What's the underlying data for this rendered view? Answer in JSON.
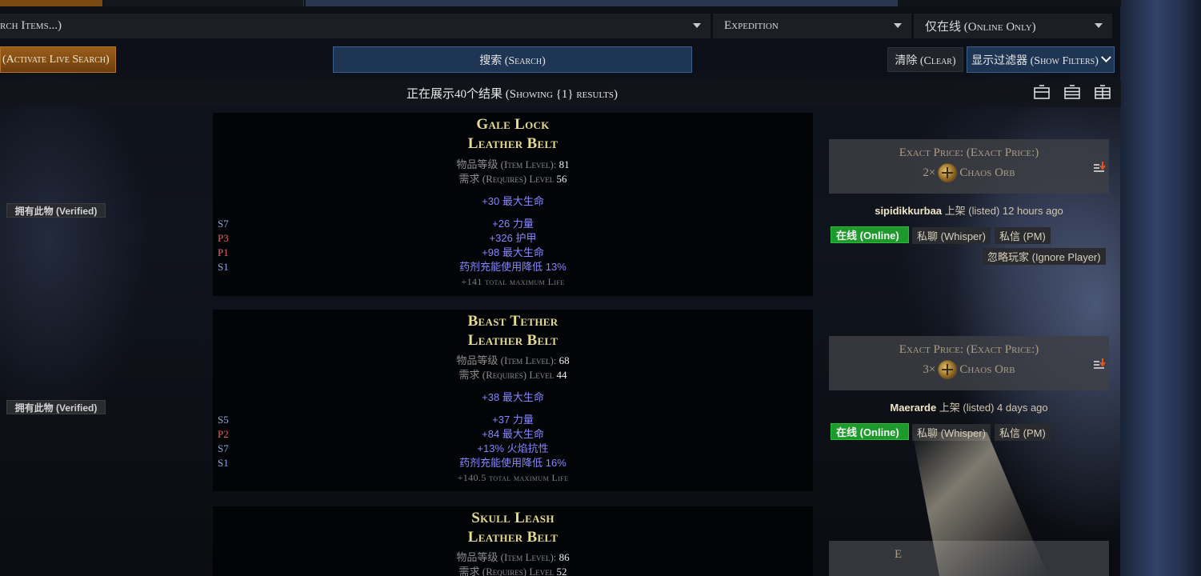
{
  "search": {
    "items_placeholder": "rch Items...)",
    "league": "Expedition",
    "status": "仅在线 (Online Only)",
    "live_search": "(Activate Live Search)",
    "search_button": "搜索 (Search)",
    "clear_button": "清除 (Clear)",
    "show_filters": "显示过滤器 (Show Filters)"
  },
  "results": {
    "count_text": "正在展示40个结果 (Showing {1} results)"
  },
  "items": [
    {
      "name": "Gale Lock",
      "base": "Leather Belt",
      "item_level_label": "物品等级 (Item Level):",
      "item_level": "81",
      "requires_label": "需求 (Requires) Level",
      "requires": "56",
      "implicit": "+30 最大生命",
      "mods": [
        {
          "tier": "S7",
          "text": "+26 力量"
        },
        {
          "tier": "P3",
          "text": "+326 护甲"
        },
        {
          "tier": "P1",
          "text": "+98 最大生命"
        },
        {
          "tier": "S1",
          "text": "药剂充能使用降低 13%"
        }
      ],
      "pseudo": "+141 total maximum Life",
      "verified": "拥有此物 (Verified)",
      "price_label": "Exact Price: (Exact Price:)",
      "price_amount": "2×",
      "currency": "Chaos Orb",
      "seller_name": "sipidikkurbaa",
      "seller_text": "上架 (listed) 12 hours ago",
      "online": "在线 (Online)",
      "whisper": "私聊 (Whisper)",
      "pm": "私信 (PM)",
      "ignore": "忽略玩家 (Ignore Player)"
    },
    {
      "name": "Beast Tether",
      "base": "Leather Belt",
      "item_level_label": "物品等级 (Item Level):",
      "item_level": "68",
      "requires_label": "需求 (Requires) Level",
      "requires": "44",
      "implicit": "+38 最大生命",
      "mods": [
        {
          "tier": "S5",
          "text": "+37 力量"
        },
        {
          "tier": "P2",
          "text": "+84 最大生命"
        },
        {
          "tier": "S7",
          "text": "+13% 火焰抗性"
        },
        {
          "tier": "S1",
          "text": "药剂充能使用降低 16%"
        }
      ],
      "pseudo": "+140.5 total maximum Life",
      "verified": "拥有此物 (Verified)",
      "price_label": "Exact Price: (Exact Price:)",
      "price_amount": "3×",
      "currency": "Chaos Orb",
      "seller_name": "Maerarde",
      "seller_text": "上架 (listed) 4 days ago",
      "online": "在线 (Online)",
      "whisper": "私聊 (Whisper)",
      "pm": "私信 (PM)"
    },
    {
      "name": "Skull Leash",
      "base": "Leather Belt",
      "item_level_label": "物品等级 (Item Level):",
      "item_level": "86",
      "requires_label": "需求 (Requires) Level",
      "requires": "52",
      "price_label_partial": "E"
    }
  ],
  "colors": {
    "item_name": "#e6dc8f",
    "magic_mod": "#8787fe",
    "suffix_tier": "#8aa7e6",
    "prefix_tier": "#e06565",
    "online": "#1d9a2b",
    "accent_blue": "#1e3553",
    "accent_orange": "#9a5e1a"
  },
  "icons": {
    "view": [
      "list-view-icon",
      "compact-view-icon",
      "grid-view-icon"
    ],
    "sort": "sort-price-icon",
    "currency": "chaos-orb-icon",
    "dropdown": "caret-down-icon"
  }
}
